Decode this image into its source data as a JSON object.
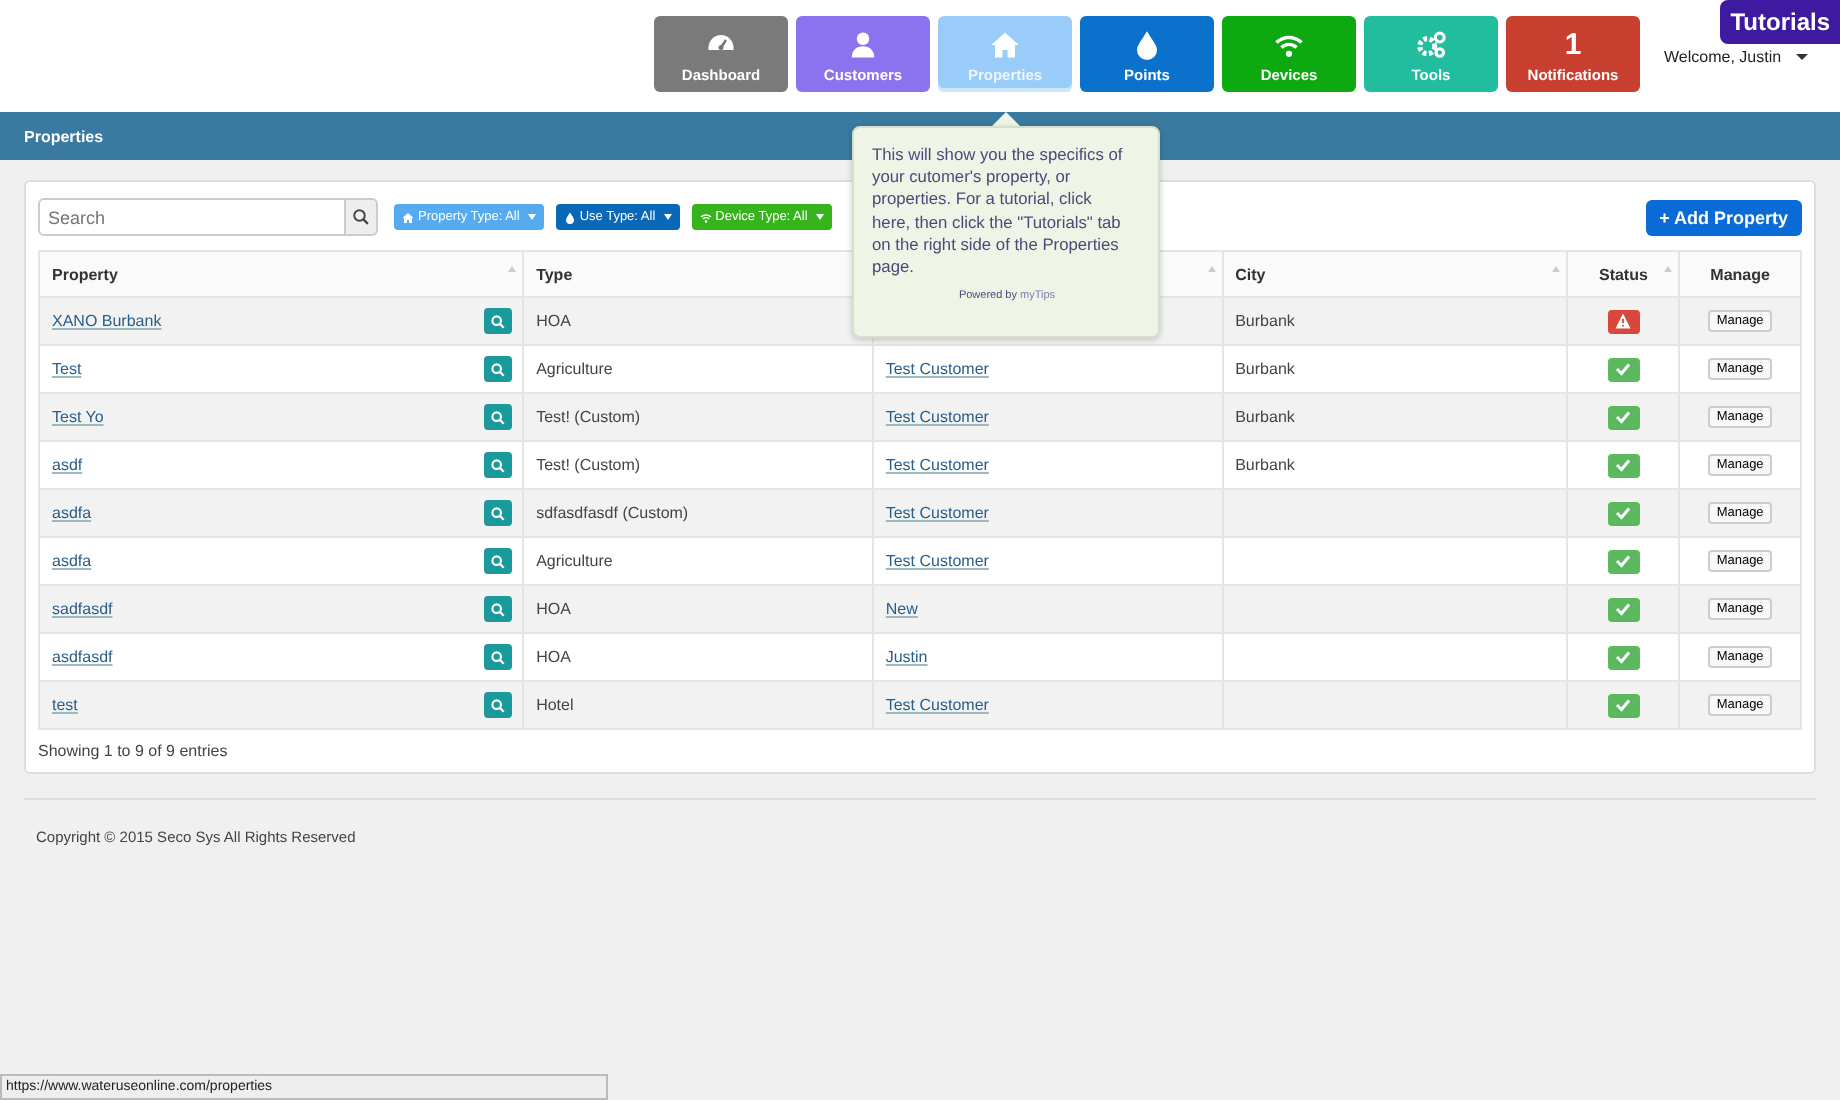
{
  "nav": [
    {
      "label": "Dashboard",
      "kind": "gauge",
      "color": "#7a7a7a",
      "selected": false
    },
    {
      "label": "Customers",
      "kind": "user",
      "color": "#8b73f0",
      "selected": false
    },
    {
      "label": "Properties",
      "kind": "house",
      "color": "#99ccf9",
      "selected": true
    },
    {
      "label": "Points",
      "kind": "drop",
      "color": "#0a72cc",
      "selected": false
    },
    {
      "label": "Devices",
      "kind": "wifi",
      "color": "#0caa10",
      "selected": false
    },
    {
      "label": "Tools",
      "kind": "gears",
      "color": "#22bd9f",
      "selected": false
    },
    {
      "label": "Notifications",
      "kind": "count",
      "count": "1",
      "color": "#c93f2f",
      "selected": false
    }
  ],
  "tutorials": "Tutorials",
  "welcome": "Welcome, Justin",
  "page_title": "Properties",
  "search": {
    "placeholder": "Search"
  },
  "filters": [
    {
      "label": "Property Type: All",
      "kind": "house",
      "color": "#55aaf0"
    },
    {
      "label": "Use Type: All",
      "kind": "drop",
      "color": "#0a68b8"
    },
    {
      "label": "Device Type: All",
      "kind": "wifi",
      "color": "#36b41c"
    }
  ],
  "add_button": "+ Add Property",
  "table": {
    "columns": [
      {
        "label": "Property",
        "sort": true
      },
      {
        "label": "Type",
        "sort": false
      },
      {
        "sort": true
      },
      {
        "label": "City",
        "sort": true
      },
      {
        "label": "Status",
        "sort": true
      },
      {
        "label": "Manage",
        "sort": false
      }
    ],
    "rows": [
      {
        "property": "XANO Burbank",
        "type": "HOA",
        "city": "Burbank",
        "kind": "alert",
        "manage": "Manage"
      },
      {
        "property": "Test",
        "type": "Agriculture",
        "customer": "Test Customer",
        "city": "Burbank",
        "kind": "ok",
        "manage": "Manage"
      },
      {
        "property": "Test Yo",
        "type": "Test! (Custom)",
        "customer": "Test Customer",
        "city": "Burbank",
        "kind": "ok",
        "manage": "Manage"
      },
      {
        "property": "asdf",
        "type": "Test! (Custom)",
        "customer": "Test Customer",
        "city": "Burbank",
        "kind": "ok",
        "manage": "Manage"
      },
      {
        "property": "asdfa",
        "type": "sdfasdfasdf (Custom)",
        "customer": "Test Customer",
        "kind": "ok",
        "manage": "Manage"
      },
      {
        "property": "asdfa",
        "type": "Agriculture",
        "customer": "Test Customer",
        "kind": "ok",
        "manage": "Manage"
      },
      {
        "property": "sadfasdf",
        "type": "HOA",
        "customer": "New",
        "kind": "ok",
        "manage": "Manage"
      },
      {
        "property": "asdfasdf",
        "type": "HOA",
        "customer": "Justin",
        "kind": "ok",
        "manage": "Manage"
      },
      {
        "property": "test",
        "type": "Hotel",
        "customer": "Test Customer",
        "kind": "ok",
        "manage": "Manage"
      }
    ]
  },
  "entries_info": "Showing 1 to 9 of 9 entries",
  "tooltip": {
    "text": "This will show you the specifics of your cutomer's property, or properties. For a tutorial, click here, then click the \"Tutorials\" tab on the right side of the Properties page.",
    "powered_by": "Powered by",
    "brand": "myTips"
  },
  "copyright": "Copyright © 2015 Seco Sys All Rights Reserved",
  "status_url": "https://www.wateruseonline.com/properties"
}
